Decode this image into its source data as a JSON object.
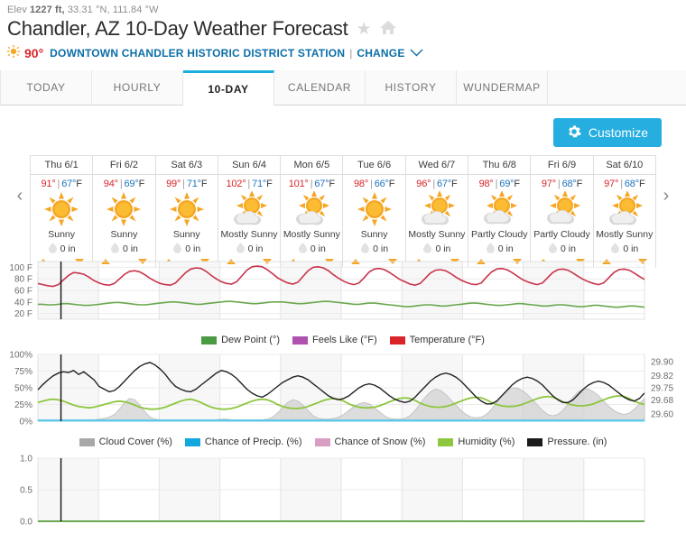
{
  "header": {
    "elevation_prefix": "Elev",
    "elevation_value": "1227 ft,",
    "coords": "33.31 °N, 111.84 °W",
    "title": "Chandler, AZ 10-Day Weather Forecast",
    "star_icon": "star-icon",
    "home_icon": "home-icon",
    "current_temp": "90°",
    "sun_icon": "sun-icon",
    "station": "DOWNTOWN CHANDLER HISTORIC DISTRICT STATION",
    "separator": "|",
    "change_label": "CHANGE",
    "chevron_icon": "chevron-down-icon"
  },
  "tabs": [
    {
      "label": "TODAY",
      "active": false
    },
    {
      "label": "HOURLY",
      "active": false
    },
    {
      "label": "10-DAY",
      "active": true
    },
    {
      "label": "CALENDAR",
      "active": false
    },
    {
      "label": "HISTORY",
      "active": false
    },
    {
      "label": "WUNDERMAP",
      "active": false
    }
  ],
  "toolbar": {
    "customize_label": "Customize",
    "gear_icon": "gear-icon"
  },
  "nav": {
    "prev_icon": "chevron-left-icon",
    "next_icon": "chevron-right-icon"
  },
  "forecast": {
    "precip_unit": "0 in",
    "days": [
      {
        "name": "Thu 6/1",
        "high": "91°",
        "low": "67°",
        "unit": "F",
        "condition": "Sunny",
        "icon": "sunny-icon",
        "precip": "0 in"
      },
      {
        "name": "Fri 6/2",
        "high": "94°",
        "low": "69°",
        "unit": "F",
        "condition": "Sunny",
        "icon": "sunny-icon",
        "precip": "0 in"
      },
      {
        "name": "Sat 6/3",
        "high": "99°",
        "low": "71°",
        "unit": "F",
        "condition": "Sunny",
        "icon": "sunny-icon",
        "precip": "0 in"
      },
      {
        "name": "Sun 6/4",
        "high": "102°",
        "low": "71°",
        "unit": "F",
        "condition": "Mostly Sunny",
        "icon": "mostly-sunny-icon",
        "precip": "0 in"
      },
      {
        "name": "Mon 6/5",
        "high": "101°",
        "low": "67°",
        "unit": "F",
        "condition": "Mostly Sunny",
        "icon": "mostly-sunny-icon",
        "precip": "0 in"
      },
      {
        "name": "Tue 6/6",
        "high": "98°",
        "low": "66°",
        "unit": "F",
        "condition": "Sunny",
        "icon": "sunny-icon",
        "precip": "0 in"
      },
      {
        "name": "Wed 6/7",
        "high": "96°",
        "low": "67°",
        "unit": "F",
        "condition": "Mostly Sunny",
        "icon": "mostly-sunny-icon",
        "precip": "0 in"
      },
      {
        "name": "Thu 6/8",
        "high": "98°",
        "low": "69°",
        "unit": "F",
        "condition": "Partly Cloudy",
        "icon": "partly-cloudy-icon",
        "precip": "0 in"
      },
      {
        "name": "Fri 6/9",
        "high": "97°",
        "low": "68°",
        "unit": "F",
        "condition": "Partly Cloudy",
        "icon": "partly-cloudy-icon",
        "precip": "0 in"
      },
      {
        "name": "Sat 6/10",
        "high": "97°",
        "low": "68°",
        "unit": "F",
        "condition": "Mostly Sunny",
        "icon": "mostly-sunny-icon",
        "precip": "0 in"
      }
    ]
  },
  "chart_data": [
    {
      "type": "line",
      "name": "temperature-chart",
      "title": "",
      "xlabel": "",
      "ylabel": "",
      "ylim": [
        10,
        110
      ],
      "yticks": [
        "20 F",
        "40 F",
        "60 F",
        "80 F",
        "100 F"
      ],
      "ytick_values": [
        20,
        40,
        60,
        80,
        100
      ],
      "grid": true,
      "legend_position": "bottom",
      "legend": [
        {
          "name": "Dew Point (°)",
          "color": "#4b9b45"
        },
        {
          "name": "Feels Like (°F)",
          "color": "#b051b0"
        },
        {
          "name": "Temperature (°F)",
          "color": "#d9252a"
        }
      ],
      "series": [
        {
          "name": "Temperature (°F)",
          "color": "#c8334a",
          "values": [
            72,
            70,
            68,
            67,
            70,
            78,
            86,
            91,
            90,
            88,
            83,
            77,
            73,
            70,
            69,
            72,
            80,
            88,
            93,
            94,
            92,
            87,
            81,
            76,
            72,
            70,
            69,
            73,
            82,
            91,
            97,
            99,
            98,
            93,
            86,
            80,
            75,
            72,
            71,
            75,
            85,
            95,
            101,
            102,
            101,
            96,
            89,
            82,
            77,
            73,
            71,
            74,
            84,
            94,
            100,
            101,
            99,
            94,
            87,
            81,
            76,
            72,
            70,
            73,
            82,
            92,
            97,
            98,
            96,
            91,
            85,
            79,
            75,
            71,
            69,
            72,
            81,
            90,
            95,
            96,
            94,
            89,
            83,
            78,
            74,
            71,
            70,
            73,
            83,
            92,
            97,
            98,
            96,
            91,
            85,
            79,
            75,
            72,
            70,
            73,
            82,
            91,
            96,
            97,
            95,
            90,
            84,
            79,
            75,
            72,
            70,
            73,
            82,
            91,
            96,
            97,
            95,
            90,
            84,
            79
          ]
        },
        {
          "name": "Dew Point (°)",
          "color": "#6aa84f",
          "values": [
            36,
            36,
            35,
            35,
            36,
            37,
            37,
            36,
            35,
            34,
            34,
            35,
            36,
            37,
            38,
            39,
            39,
            38,
            37,
            36,
            35,
            35,
            36,
            37,
            38,
            39,
            40,
            40,
            39,
            38,
            37,
            36,
            36,
            37,
            38,
            39,
            40,
            41,
            41,
            40,
            39,
            38,
            37,
            37,
            38,
            39,
            40,
            40,
            40,
            39,
            38,
            37,
            37,
            38,
            39,
            40,
            41,
            41,
            40,
            39,
            38,
            37,
            36,
            36,
            37,
            38,
            38,
            37,
            36,
            35,
            34,
            33,
            32,
            32,
            33,
            34,
            35,
            35,
            34,
            33,
            33,
            34,
            35,
            36,
            37,
            38,
            38,
            37,
            36,
            35,
            34,
            34,
            35,
            36,
            37,
            37,
            36,
            35,
            34,
            33,
            33,
            34,
            35,
            35,
            34,
            33,
            32,
            32,
            33,
            34,
            34,
            33,
            32,
            31,
            31,
            32,
            33,
            33,
            32,
            31
          ]
        },
        {
          "name": "Feels Like (°F)",
          "color": "#b051b0",
          "values": []
        }
      ]
    },
    {
      "type": "line",
      "name": "conditions-chart",
      "title": "",
      "xlabel": "",
      "ylabel": "",
      "ylim": [
        0,
        100
      ],
      "yticks": [
        "0%",
        "25%",
        "50%",
        "75%",
        "100%"
      ],
      "ytick_values": [
        0,
        25,
        50,
        75,
        100
      ],
      "y2ticks": [
        "29.60",
        "29.68",
        "29.75",
        "29.82",
        "29.90"
      ],
      "y2tick_values": [
        29.6,
        29.68,
        29.75,
        29.82,
        29.9
      ],
      "y2lim": [
        29.56,
        29.94
      ],
      "grid": true,
      "legend_position": "bottom",
      "legend": [
        {
          "name": "Cloud Cover (%)",
          "color": "#a8a8a8"
        },
        {
          "name": "Chance of Precip. (%)",
          "color": "#13a8dd"
        },
        {
          "name": "Chance of Snow (%)",
          "color": "#d89ec4"
        },
        {
          "name": "Humidity (%)",
          "color": "#8dc63f"
        },
        {
          "name": "Pressure. (in)",
          "color": "#1a1a1a"
        }
      ],
      "series": [
        {
          "name": "Pressure. (in)",
          "color": "#222222",
          "axis": "right",
          "values": [
            47,
            55,
            62,
            68,
            72,
            74,
            73,
            76,
            70,
            74,
            68,
            62,
            52,
            48,
            44,
            46,
            52,
            60,
            68,
            76,
            82,
            86,
            88,
            84,
            78,
            70,
            60,
            52,
            48,
            45,
            44,
            48,
            54,
            60,
            66,
            72,
            76,
            74,
            70,
            64,
            56,
            48,
            42,
            38,
            36,
            40,
            46,
            52,
            58,
            62,
            66,
            68,
            66,
            62,
            56,
            50,
            44,
            38,
            34,
            32,
            34,
            38,
            44,
            50,
            54,
            56,
            54,
            50,
            44,
            38,
            33,
            30,
            28,
            30,
            36,
            44,
            52,
            60,
            66,
            70,
            72,
            70,
            66,
            60,
            52,
            44,
            36,
            30,
            26,
            26,
            30,
            38,
            46,
            54,
            60,
            64,
            66,
            64,
            60,
            54,
            46,
            38,
            32,
            28,
            28,
            32,
            40,
            48,
            54,
            58,
            60,
            58,
            54,
            48,
            42,
            36,
            32,
            30,
            34,
            42
          ]
        },
        {
          "name": "Humidity (%)",
          "color": "#8dc63f",
          "axis": "left",
          "values": [
            28,
            30,
            32,
            33,
            32,
            30,
            27,
            24,
            22,
            21,
            20,
            21,
            23,
            25,
            27,
            29,
            30,
            29,
            27,
            24,
            21,
            19,
            18,
            18,
            19,
            21,
            24,
            27,
            30,
            32,
            33,
            31,
            28,
            24,
            21,
            19,
            18,
            18,
            19,
            21,
            24,
            27,
            30,
            32,
            33,
            32,
            29,
            25,
            22,
            20,
            19,
            19,
            20,
            22,
            25,
            28,
            31,
            33,
            34,
            33,
            30,
            26,
            23,
            21,
            20,
            20,
            21,
            23,
            26,
            29,
            32,
            34,
            35,
            34,
            31,
            27,
            24,
            22,
            21,
            21,
            22,
            24,
            27,
            30,
            33,
            35,
            36,
            35,
            32,
            28,
            25,
            23,
            22,
            22,
            23,
            25,
            28,
            31,
            34,
            36,
            37,
            36,
            33,
            29,
            26,
            24,
            23,
            23,
            24,
            26,
            29,
            32,
            35,
            37,
            38,
            37,
            34,
            30,
            27,
            25
          ]
        },
        {
          "name": "Cloud Cover (%)",
          "color": "#c9c9c9",
          "axis": "left",
          "fill": true,
          "values": [
            2,
            2,
            2,
            2,
            2,
            2,
            2,
            2,
            2,
            2,
            2,
            2,
            3,
            4,
            6,
            10,
            18,
            28,
            34,
            32,
            24,
            14,
            6,
            3,
            2,
            2,
            2,
            2,
            2,
            2,
            2,
            2,
            2,
            2,
            2,
            2,
            3,
            3,
            2,
            2,
            2,
            2,
            2,
            2,
            2,
            3,
            6,
            12,
            20,
            28,
            32,
            30,
            24,
            16,
            8,
            4,
            3,
            3,
            4,
            6,
            10,
            16,
            22,
            26,
            28,
            26,
            20,
            14,
            8,
            4,
            3,
            3,
            4,
            8,
            16,
            26,
            36,
            44,
            48,
            46,
            40,
            32,
            24,
            16,
            10,
            6,
            5,
            6,
            10,
            18,
            28,
            38,
            46,
            50,
            50,
            46,
            40,
            32,
            24,
            16,
            10,
            8,
            10,
            16,
            26,
            36,
            44,
            48,
            48,
            44,
            38,
            30,
            22,
            16,
            12,
            10,
            12,
            18,
            26,
            34
          ]
        },
        {
          "name": "Chance of Precip. (%)",
          "color": "#4fc3e8",
          "axis": "left",
          "values": [
            1,
            1,
            1,
            1,
            1,
            1,
            1,
            1,
            1,
            1,
            1,
            1,
            1,
            1,
            1,
            1,
            1,
            1,
            1,
            1,
            1,
            1,
            1,
            1,
            1,
            1,
            1,
            1,
            1,
            1,
            1,
            1,
            1,
            1,
            1,
            1,
            1,
            1,
            1,
            1,
            1,
            1,
            1,
            1,
            1,
            1,
            1,
            1,
            1,
            1,
            1,
            1,
            1,
            1,
            1,
            1,
            1,
            1,
            1,
            1,
            1,
            1,
            1,
            1,
            1,
            1,
            1,
            1,
            1,
            1,
            1,
            1,
            1,
            1,
            1,
            1,
            1,
            1,
            1,
            1,
            1,
            1,
            1,
            1,
            1,
            1,
            1,
            1,
            1,
            1,
            1,
            1,
            1,
            1,
            1,
            1,
            1,
            1,
            1,
            1,
            1,
            1,
            1,
            1,
            1,
            1,
            1,
            1,
            1,
            1,
            1,
            1,
            1,
            1,
            1,
            1,
            1,
            1,
            1,
            1
          ]
        },
        {
          "name": "Chance of Snow (%)",
          "color": "#d89ec4",
          "axis": "left",
          "values": []
        }
      ]
    },
    {
      "type": "line",
      "name": "accumulation-chart",
      "title": "",
      "xlabel": "",
      "ylabel": "",
      "ylim": [
        0,
        1
      ],
      "yticks": [
        "0.0",
        "0.5",
        "1.0"
      ],
      "ytick_values": [
        0.0,
        0.5,
        1.0
      ],
      "grid": true,
      "series": [
        {
          "name": "accumulation",
          "color": "#6aa84f",
          "values": [
            0,
            0,
            0,
            0,
            0,
            0,
            0,
            0,
            0,
            0,
            0,
            0,
            0,
            0,
            0,
            0,
            0,
            0,
            0,
            0,
            0,
            0,
            0,
            0,
            0,
            0,
            0,
            0,
            0,
            0,
            0,
            0,
            0,
            0,
            0,
            0,
            0,
            0,
            0,
            0,
            0,
            0,
            0,
            0,
            0,
            0,
            0,
            0,
            0,
            0,
            0,
            0,
            0,
            0,
            0,
            0,
            0,
            0,
            0,
            0,
            0,
            0,
            0,
            0,
            0,
            0,
            0,
            0,
            0,
            0,
            0,
            0,
            0,
            0,
            0,
            0,
            0,
            0,
            0,
            0,
            0,
            0,
            0,
            0,
            0,
            0,
            0,
            0,
            0,
            0,
            0,
            0,
            0,
            0,
            0,
            0,
            0,
            0,
            0,
            0,
            0,
            0,
            0,
            0,
            0,
            0,
            0,
            0,
            0,
            0,
            0,
            0,
            0,
            0,
            0,
            0,
            0,
            0,
            0,
            0
          ]
        }
      ]
    }
  ]
}
